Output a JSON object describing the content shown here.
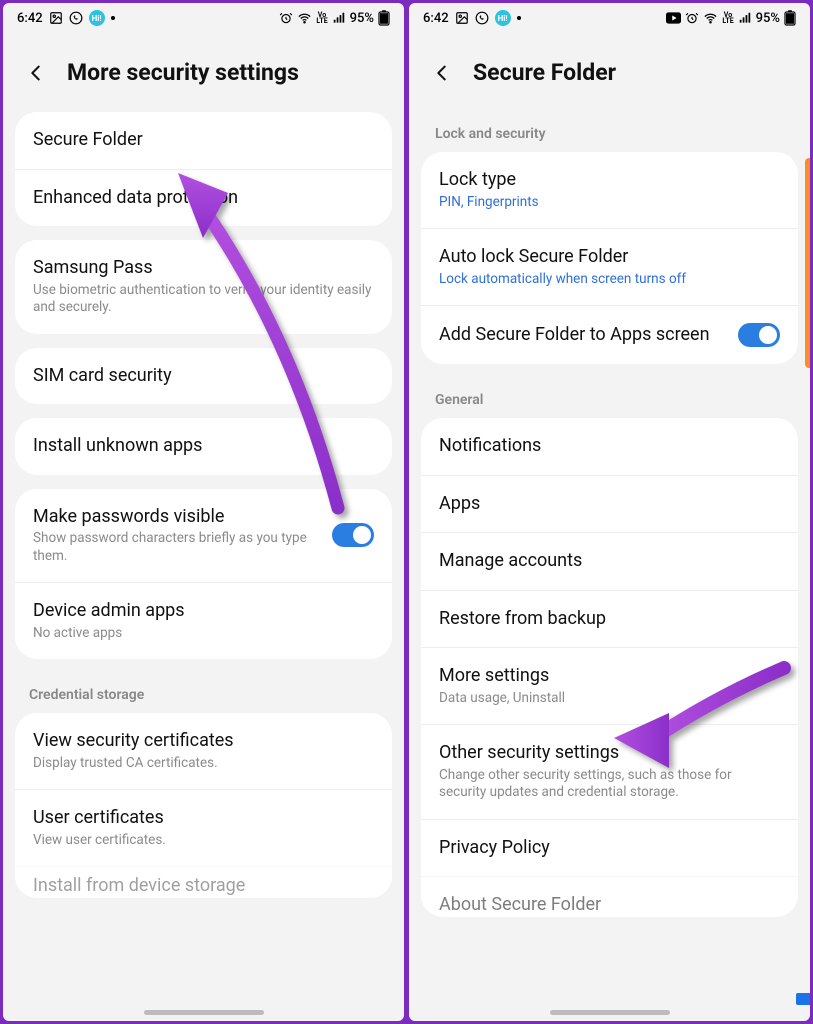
{
  "status": {
    "time": "6:42",
    "battery_pct": "95%",
    "volte": "VoLTE"
  },
  "left": {
    "title": "More security settings",
    "rows": {
      "secure_folder": "Secure Folder",
      "enhanced_data": "Enhanced data protection",
      "samsung_pass": "Samsung Pass",
      "samsung_pass_sub": "Use biometric authentication to verify your identity easily and securely.",
      "sim": "SIM card security",
      "install_unknown": "Install unknown apps",
      "make_pw_visible": "Make passwords visible",
      "make_pw_visible_sub": "Show password characters briefly as you type them.",
      "device_admin": "Device admin apps",
      "device_admin_sub": "No active apps",
      "view_sec_certs": "View security certificates",
      "view_sec_certs_sub": "Display trusted CA certificates.",
      "user_certs": "User certificates",
      "user_certs_sub": "View user certificates.",
      "install_from_storage": "Install from device storage"
    },
    "sections": {
      "credential_storage": "Credential storage"
    }
  },
  "right": {
    "title": "Secure Folder",
    "sections": {
      "lock_security": "Lock and security",
      "general": "General"
    },
    "rows": {
      "lock_type": "Lock type",
      "lock_type_sub": "PIN, Fingerprints",
      "auto_lock": "Auto lock Secure Folder",
      "auto_lock_sub": "Lock automatically when screen turns off",
      "add_to_apps": "Add Secure Folder to Apps screen",
      "notifications": "Notifications",
      "apps": "Apps",
      "manage_accounts": "Manage accounts",
      "restore": "Restore from backup",
      "more_settings": "More settings",
      "more_settings_sub": "Data usage, Uninstall",
      "other_sec": "Other security settings",
      "other_sec_sub": "Change other security settings, such as those for security updates and credential storage.",
      "privacy": "Privacy Policy",
      "about": "About Secure Folder"
    }
  }
}
